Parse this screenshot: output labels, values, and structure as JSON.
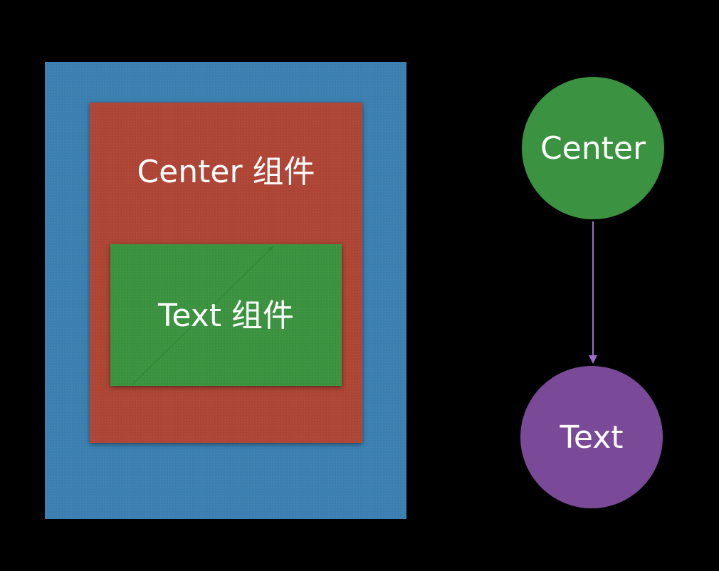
{
  "widget_tree": {
    "center_box_label": "Center 组件",
    "text_box_label": "Text  组件"
  },
  "nodes": {
    "center": "Center",
    "text": "Text"
  },
  "colors": {
    "background": "#000000",
    "outer_box": "#3a7fb0",
    "center_box": "#ad4434",
    "text_box": "#3a923f",
    "center_node": "#3b9240",
    "text_node": "#7a4a99",
    "connector": "#9a6fd0"
  }
}
